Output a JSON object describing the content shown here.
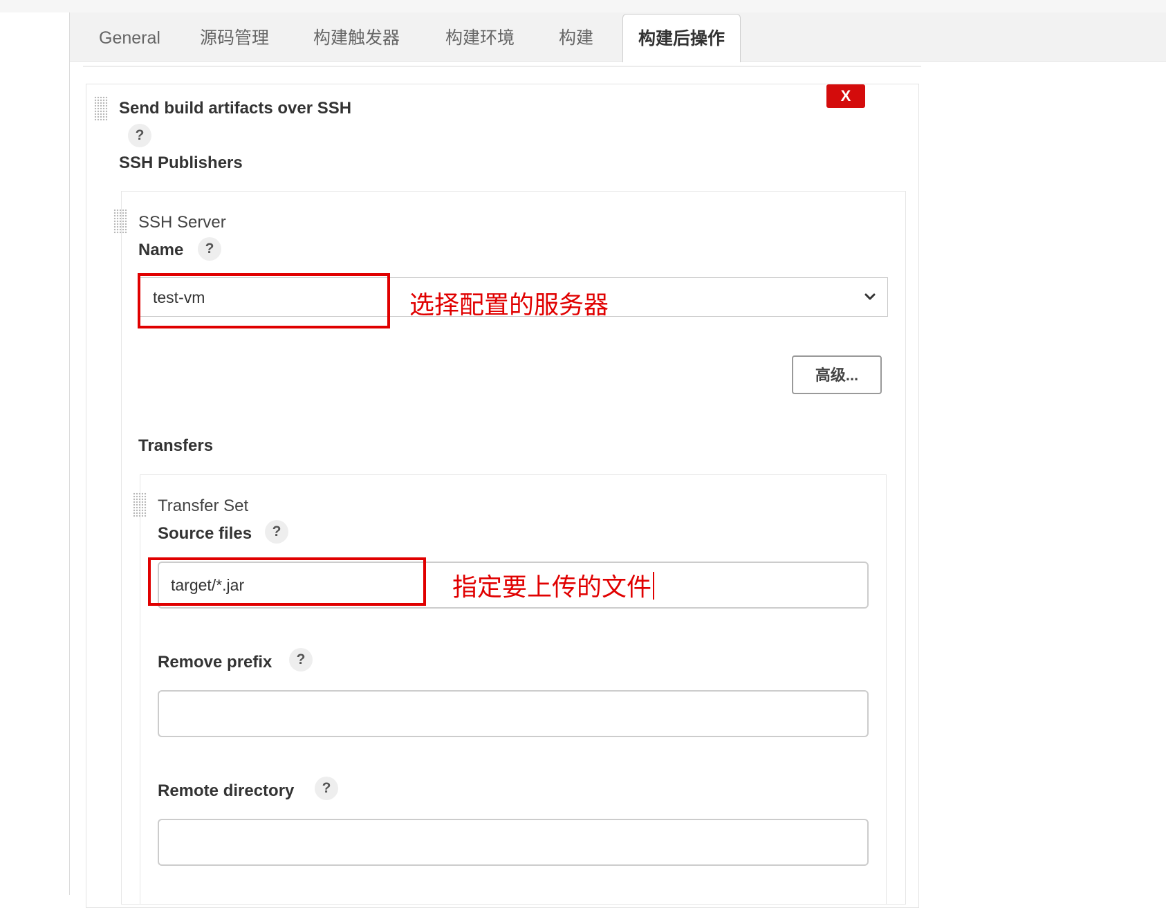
{
  "tabs": [
    {
      "label": "General"
    },
    {
      "label": "源码管理"
    },
    {
      "label": "构建触发器"
    },
    {
      "label": "构建环境"
    },
    {
      "label": "构建"
    },
    {
      "label": "构建后操作",
      "active": true
    }
  ],
  "section": {
    "title": "Send build artifacts over SSH",
    "delete_label": "X",
    "help_label": "?",
    "publishers_label": "SSH Publishers"
  },
  "ssh_server": {
    "title": "SSH Server",
    "name_label": "Name",
    "name_value": "test-vm",
    "advanced_label": "高级..."
  },
  "transfers": {
    "label": "Transfers",
    "set_title": "Transfer Set",
    "source_files_label": "Source files",
    "source_files_value": "target/*.jar",
    "remove_prefix_label": "Remove prefix",
    "remove_prefix_value": "",
    "remote_directory_label": "Remote directory",
    "remote_directory_value": ""
  },
  "annotations": {
    "server_note": "选择配置的服务器",
    "files_note": "指定要上传的文件",
    "color": "#e00000"
  }
}
